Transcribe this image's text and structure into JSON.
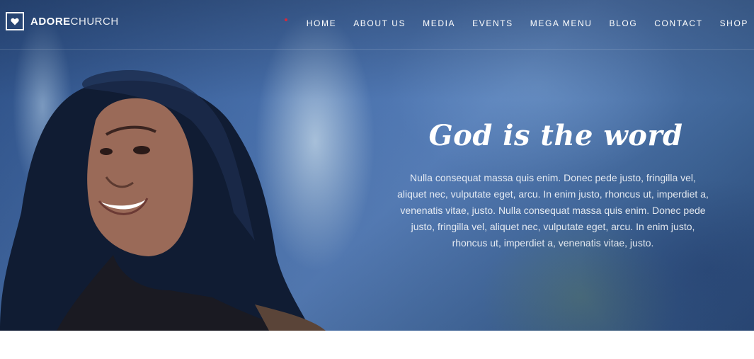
{
  "brand": {
    "name_bold": "ADORE",
    "name_light": "CHURCH",
    "logo_icon": "heart-icon"
  },
  "nav": {
    "items": [
      {
        "label": "HOME"
      },
      {
        "label": "ABOUT US"
      },
      {
        "label": "MEDIA"
      },
      {
        "label": "EVENTS"
      },
      {
        "label": "MEGA MENU"
      },
      {
        "label": "BLOG"
      },
      {
        "label": "CONTACT"
      },
      {
        "label": "SHOP"
      }
    ],
    "indicator_color": "#d8283a"
  },
  "hero": {
    "title": "God is the word",
    "body": "Nulla consequat massa quis enim. Donec pede justo, fringilla vel, aliquet nec, vulputate eget, arcu. In enim justo, rhoncus ut, imperdiet a, venenatis vitae, justo. Nulla consequat massa quis enim. Donec pede justo, fringilla vel, aliquet nec, vulputate eget, arcu. In enim justo, rhoncus ut, imperdiet a, venenatis vitae, justo."
  },
  "colors": {
    "text_on_hero": "#ffffff",
    "hero_tint": "#3f6699"
  }
}
